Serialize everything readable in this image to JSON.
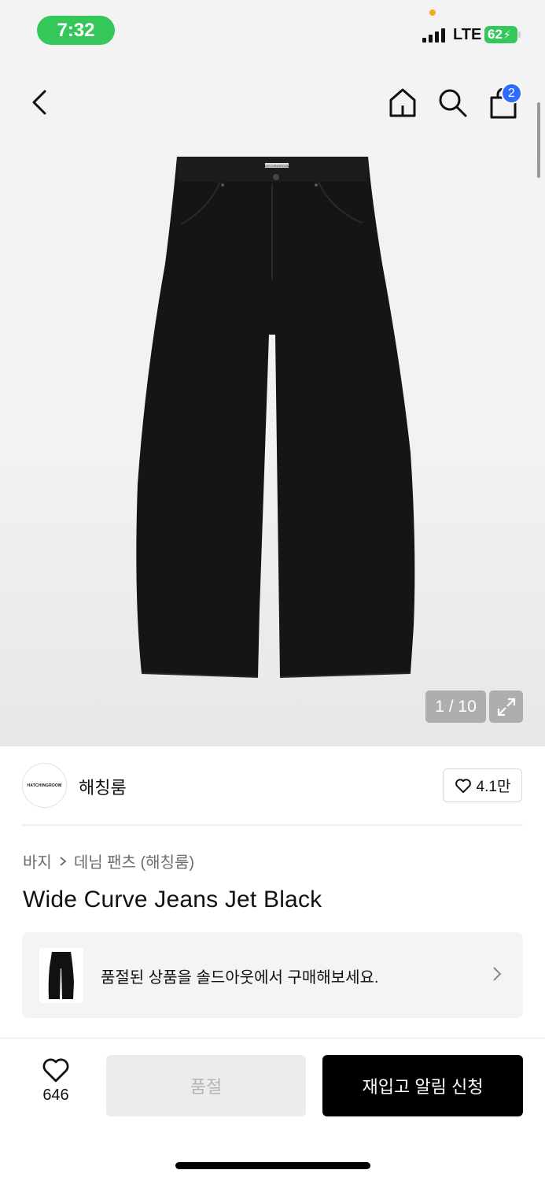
{
  "status_bar": {
    "time": "7:32",
    "network": "LTE",
    "battery": "62"
  },
  "nav": {
    "cart_count": "2"
  },
  "gallery": {
    "counter": "1 / 10",
    "waistband_label": "HATCHINGROOM"
  },
  "brand": {
    "logo_text": "HATCHINGROOM",
    "name": "해칭룸",
    "likes": "4.1만"
  },
  "breadcrumb": {
    "category": "바지",
    "subcategory": "데님 팬츠 (해칭룸)"
  },
  "product": {
    "title": "Wide Curve Jeans Jet Black"
  },
  "soldout_banner": {
    "text": "품절된 상품을 솔드아웃에서 구매해보세요."
  },
  "bottom_bar": {
    "wish_count": "646",
    "soldout_label": "품절",
    "restock_label": "재입고 알림 신청"
  },
  "colors": {
    "status_green": "#35c759",
    "badge_blue": "#2f6bff",
    "primary_button": "#000000"
  }
}
